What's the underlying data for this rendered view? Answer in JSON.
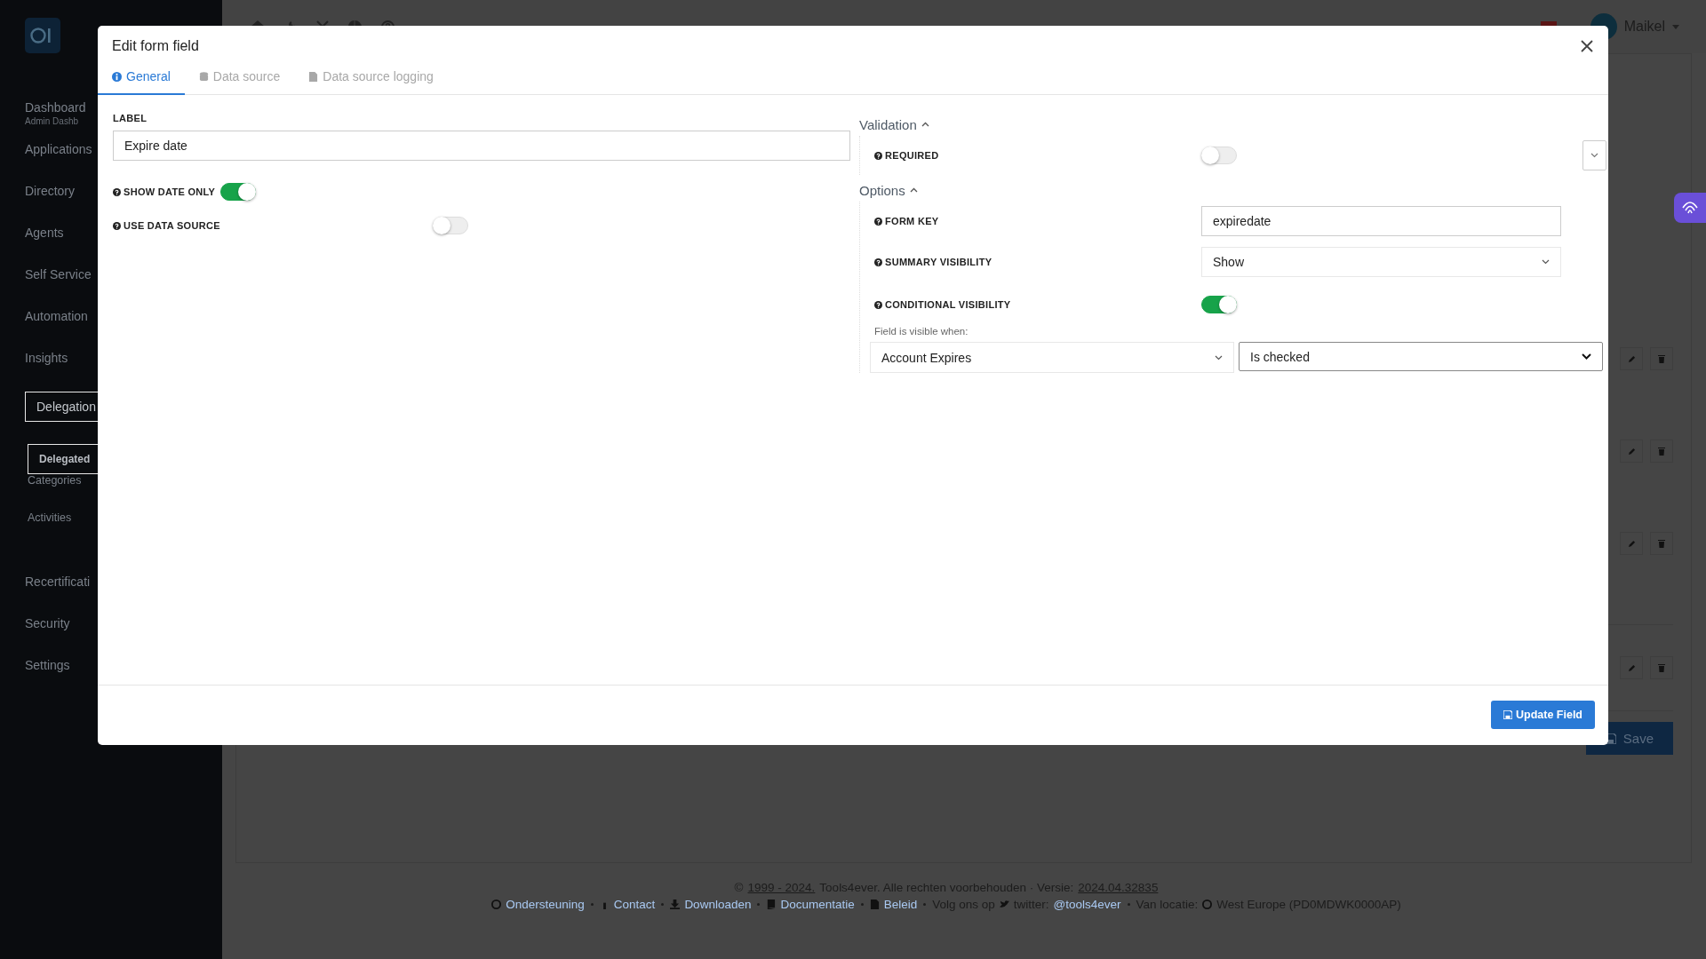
{
  "sidebar": {
    "items": [
      {
        "label": "Dashboard",
        "sublabel": "Admin Dashb",
        "selected": false
      },
      {
        "label": "Applications",
        "selected": false
      },
      {
        "label": "Directory",
        "selected": false
      },
      {
        "label": "Agents",
        "selected": false
      },
      {
        "label": "Self Service",
        "selected": false
      },
      {
        "label": "Automation",
        "selected": false
      },
      {
        "label": "Insights",
        "selected": false
      },
      {
        "label": "Delegation",
        "selected": true,
        "children": [
          {
            "label": "Delegated",
            "selected": true
          },
          {
            "label": "Categories",
            "selected": false
          },
          {
            "label": "Activities",
            "selected": false
          }
        ]
      },
      {
        "label": "Recertificati",
        "selected": false
      },
      {
        "label": "Security",
        "selected": false
      },
      {
        "label": "Settings",
        "selected": false
      }
    ]
  },
  "topbar": {
    "user": "Maikel"
  },
  "dialog": {
    "title": "Edit form field",
    "tabs": [
      {
        "label": "General",
        "selected": true,
        "disabled": false
      },
      {
        "label": "Data source",
        "selected": false,
        "disabled": true
      },
      {
        "label": "Data source logging",
        "selected": false,
        "disabled": true
      }
    ],
    "fields": [
      {
        "kind": "text",
        "label": "LABEL",
        "value": "Expire date"
      },
      {
        "kind": "toggle",
        "label": "SHOW DATE ONLY",
        "on": true
      },
      {
        "kind": "toggle",
        "label": "USE DATA SOURCE",
        "on": false
      }
    ],
    "sections": [
      {
        "title": "Validation",
        "expanded": true,
        "rows": [
          {
            "kind": "toggle",
            "label": "REQUIRED",
            "on": false
          }
        ]
      },
      {
        "title": "Options",
        "expanded": true,
        "rows": [
          {
            "kind": "text",
            "label": "FORM KEY",
            "value": "expiredate"
          },
          {
            "kind": "select",
            "label": "SUMMARY VISIBILITY",
            "value": "Show"
          },
          {
            "kind": "toggle",
            "label": "CONDITIONAL VISIBILITY",
            "on": true
          }
        ],
        "condition": {
          "caption": "Field is visible when:",
          "field": "Account Expires",
          "operator": "Is checked"
        }
      }
    ],
    "submit": "Update Field"
  },
  "background": {
    "save": "Save"
  },
  "footer": {
    "copyright": [
      {
        "kind": "text",
        "text": "©"
      },
      {
        "kind": "link",
        "text": "1999 - 2024."
      },
      {
        "kind": "text",
        "text": "Tools4ever. Alle rechten voorbehouden · Versie:"
      },
      {
        "kind": "link",
        "text": "2024.04.32835"
      }
    ],
    "links": [
      {
        "kind": "link",
        "text": "Ondersteuning"
      },
      {
        "kind": "sep"
      },
      {
        "kind": "link",
        "text": "Contact"
      },
      {
        "kind": "sep"
      },
      {
        "kind": "link",
        "text": "Downloaden"
      },
      {
        "kind": "sep"
      },
      {
        "kind": "link",
        "text": "Documentatie"
      },
      {
        "kind": "sep"
      },
      {
        "kind": "link",
        "text": "Beleid"
      },
      {
        "kind": "sep"
      },
      {
        "kind": "text",
        "text": "Volg ons op"
      },
      {
        "kind": "text",
        "text": "twitter:"
      },
      {
        "kind": "link",
        "text": "@tools4ever"
      },
      {
        "kind": "sep"
      },
      {
        "kind": "text",
        "text": "Van locatie:"
      },
      {
        "kind": "text",
        "text": "West Europe (PD0MDWK0000AP)"
      }
    ]
  }
}
